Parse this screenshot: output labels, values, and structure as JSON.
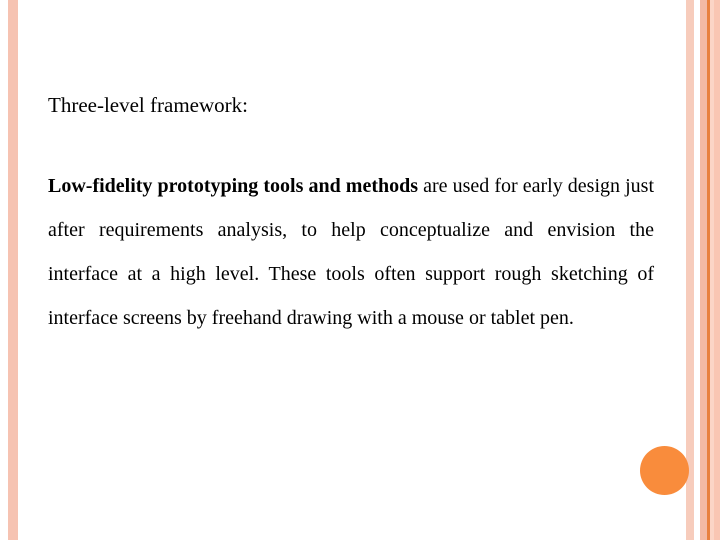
{
  "slide": {
    "heading": "Three-level framework:",
    "paragraph": {
      "bold_lead": "Low-fidelity prototyping tools and methods",
      "rest": " are used for early design just after requirements analysis, to help conceptualize and envision the interface at a high level. These tools often support rough sketching of interface screens by freehand drawing with a mouse or tablet pen."
    }
  },
  "decorations": {
    "left_bar_color": "#f6c3b2",
    "circle_color": "#f98c3c",
    "stripe_colors": {
      "outer_peach": "#f7ccbc",
      "white_gap": "#ffffff",
      "mid_peach": "#f3b9a4",
      "accent_orange": "#e8803f",
      "light_peach": "#fbd5c6",
      "inner_peach": "#f9c6b3"
    }
  }
}
